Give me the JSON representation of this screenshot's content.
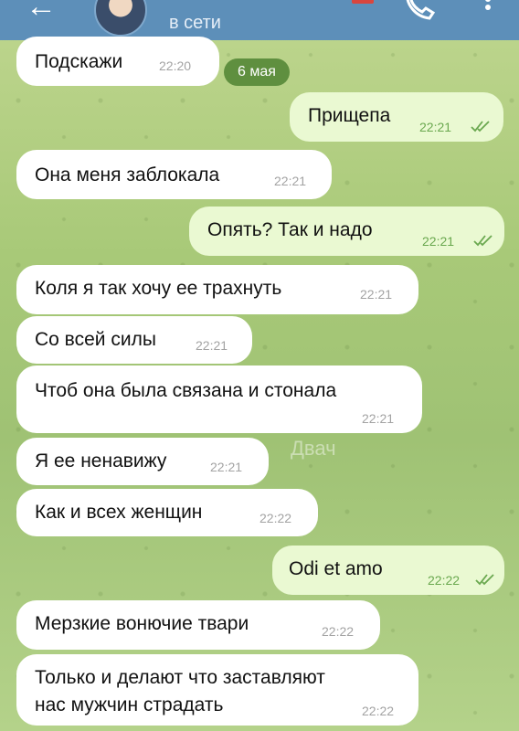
{
  "header": {
    "status": "в сети"
  },
  "date_divider": "6 мая",
  "watermark": "Двач",
  "messages": [
    {
      "dir": "in",
      "text": "Подскажи",
      "time": "22:20"
    },
    {
      "dir": "out",
      "text": "Прищепа",
      "time": "22:21"
    },
    {
      "dir": "in",
      "text": "Она меня заблокала",
      "time": "22:21"
    },
    {
      "dir": "out",
      "text": "Опять? Так и надо",
      "time": "22:21"
    },
    {
      "dir": "in",
      "text": "Коля я так хочу ее трахнуть",
      "time": "22:21"
    },
    {
      "dir": "in",
      "text": "Со всей силы",
      "time": "22:21"
    },
    {
      "dir": "in",
      "text": "Чтоб она была связана и стонала",
      "time": "22:21"
    },
    {
      "dir": "in",
      "text": "Я ее ненавижу",
      "time": "22:21"
    },
    {
      "dir": "in",
      "text": "Как и всех женщин",
      "time": "22:22"
    },
    {
      "dir": "out",
      "text": "Odi et amo",
      "time": "22:22"
    },
    {
      "dir": "in",
      "text": "Мерзкие вонючие твари",
      "time": "22:22"
    },
    {
      "dir": "in",
      "text_line1": "Только и делают что заставляют",
      "text_line2": "нас мужчин страдать",
      "time": "22:22"
    }
  ],
  "colors": {
    "header": "#5d8fb9",
    "incoming": "#ffffff",
    "outgoing": "#eaf9d2",
    "read_ticks": "#6aa84f"
  }
}
